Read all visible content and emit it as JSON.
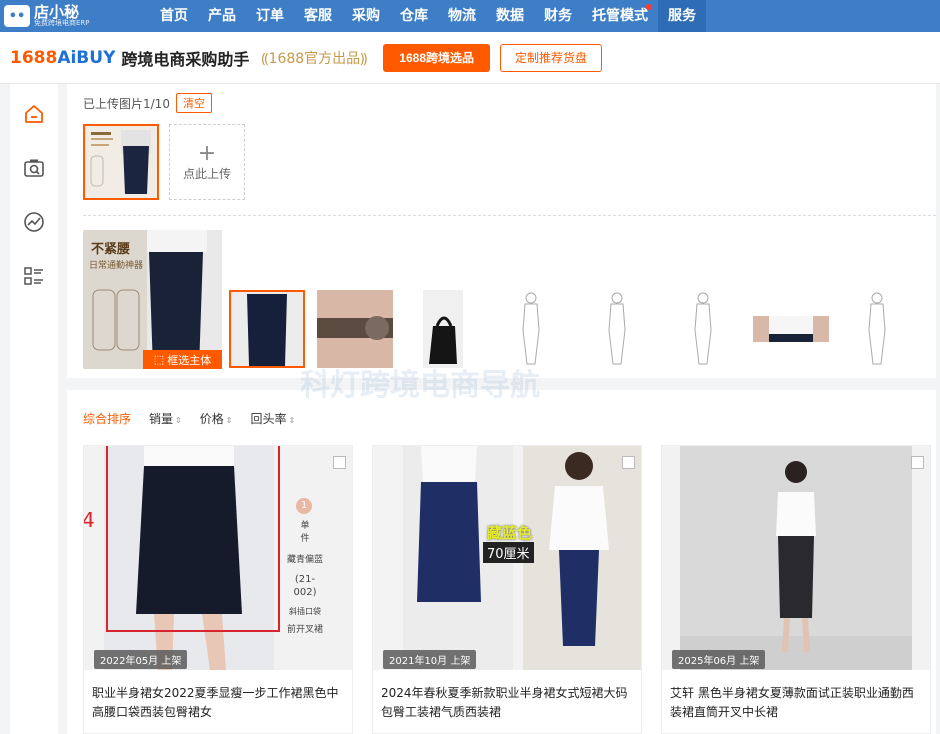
{
  "topnav": {
    "logo_mark": "••",
    "logo_title": "店小秘",
    "logo_sub": "免费跨境电商ERP",
    "items": [
      {
        "label": "首页"
      },
      {
        "label": "产品"
      },
      {
        "label": "订单"
      },
      {
        "label": "客服"
      },
      {
        "label": "采购"
      },
      {
        "label": "仓库"
      },
      {
        "label": "物流"
      },
      {
        "label": "数据"
      },
      {
        "label": "财务"
      },
      {
        "label": "托管模式"
      },
      {
        "label": "服务"
      }
    ],
    "accent": "#3d7ec7"
  },
  "header": {
    "brand_1688": "1688",
    "brand_aibuy": "AiBUY",
    "subtitle": "跨境电商采购助手",
    "official": "1688官方出品",
    "primary_button": "1688跨境选品",
    "outline_button": "定制推荐货盘",
    "accent": "#ff5a00"
  },
  "sidebar": {
    "icons": [
      "home-icon",
      "camera-search-icon",
      "trend-icon",
      "list-grid-icon"
    ]
  },
  "upload": {
    "count_text": "已上传图片1/10",
    "clear_label": "清空",
    "upload_plus": "+",
    "upload_label": "点此上传",
    "big_image_text_1": "不紧腰",
    "big_image_text_2": "日常通勤神器",
    "frame_button": "框选主体"
  },
  "results": {
    "sorts": [
      {
        "label": "综合排序",
        "active": true
      },
      {
        "label": "销量",
        "arrow": "⇕"
      },
      {
        "label": "价格",
        "arrow": "⇕"
      },
      {
        "label": "回头率",
        "arrow": "⇕"
      }
    ],
    "cards": [
      {
        "date": "2022年05月 上架",
        "title": "职业半身裙女2022夏季显瘦一步工作裙黑色中高腰口袋西装包臀裙女",
        "annot_number": "4",
        "side_badge": "1",
        "side_1": "单",
        "side_2": "件",
        "side_3": "藏青偏蓝",
        "side_4": "(21-002)",
        "side_5": "斜插口袋",
        "side_6": "前开叉裙"
      },
      {
        "date": "2021年10月 上架",
        "title": "2024年春秋夏季新款职业半身裙女式短裙大码包臀工装裙气质西装裙",
        "overlay_1": "藏蓝色",
        "overlay_2": "70厘米"
      },
      {
        "date": "2025年06月 上架",
        "title": "艾轩 黑色半身裙女夏薄款面试正装职业通勤西装裙直筒开叉中长裙"
      }
    ]
  },
  "watermark": "科灯跨境电商导航"
}
